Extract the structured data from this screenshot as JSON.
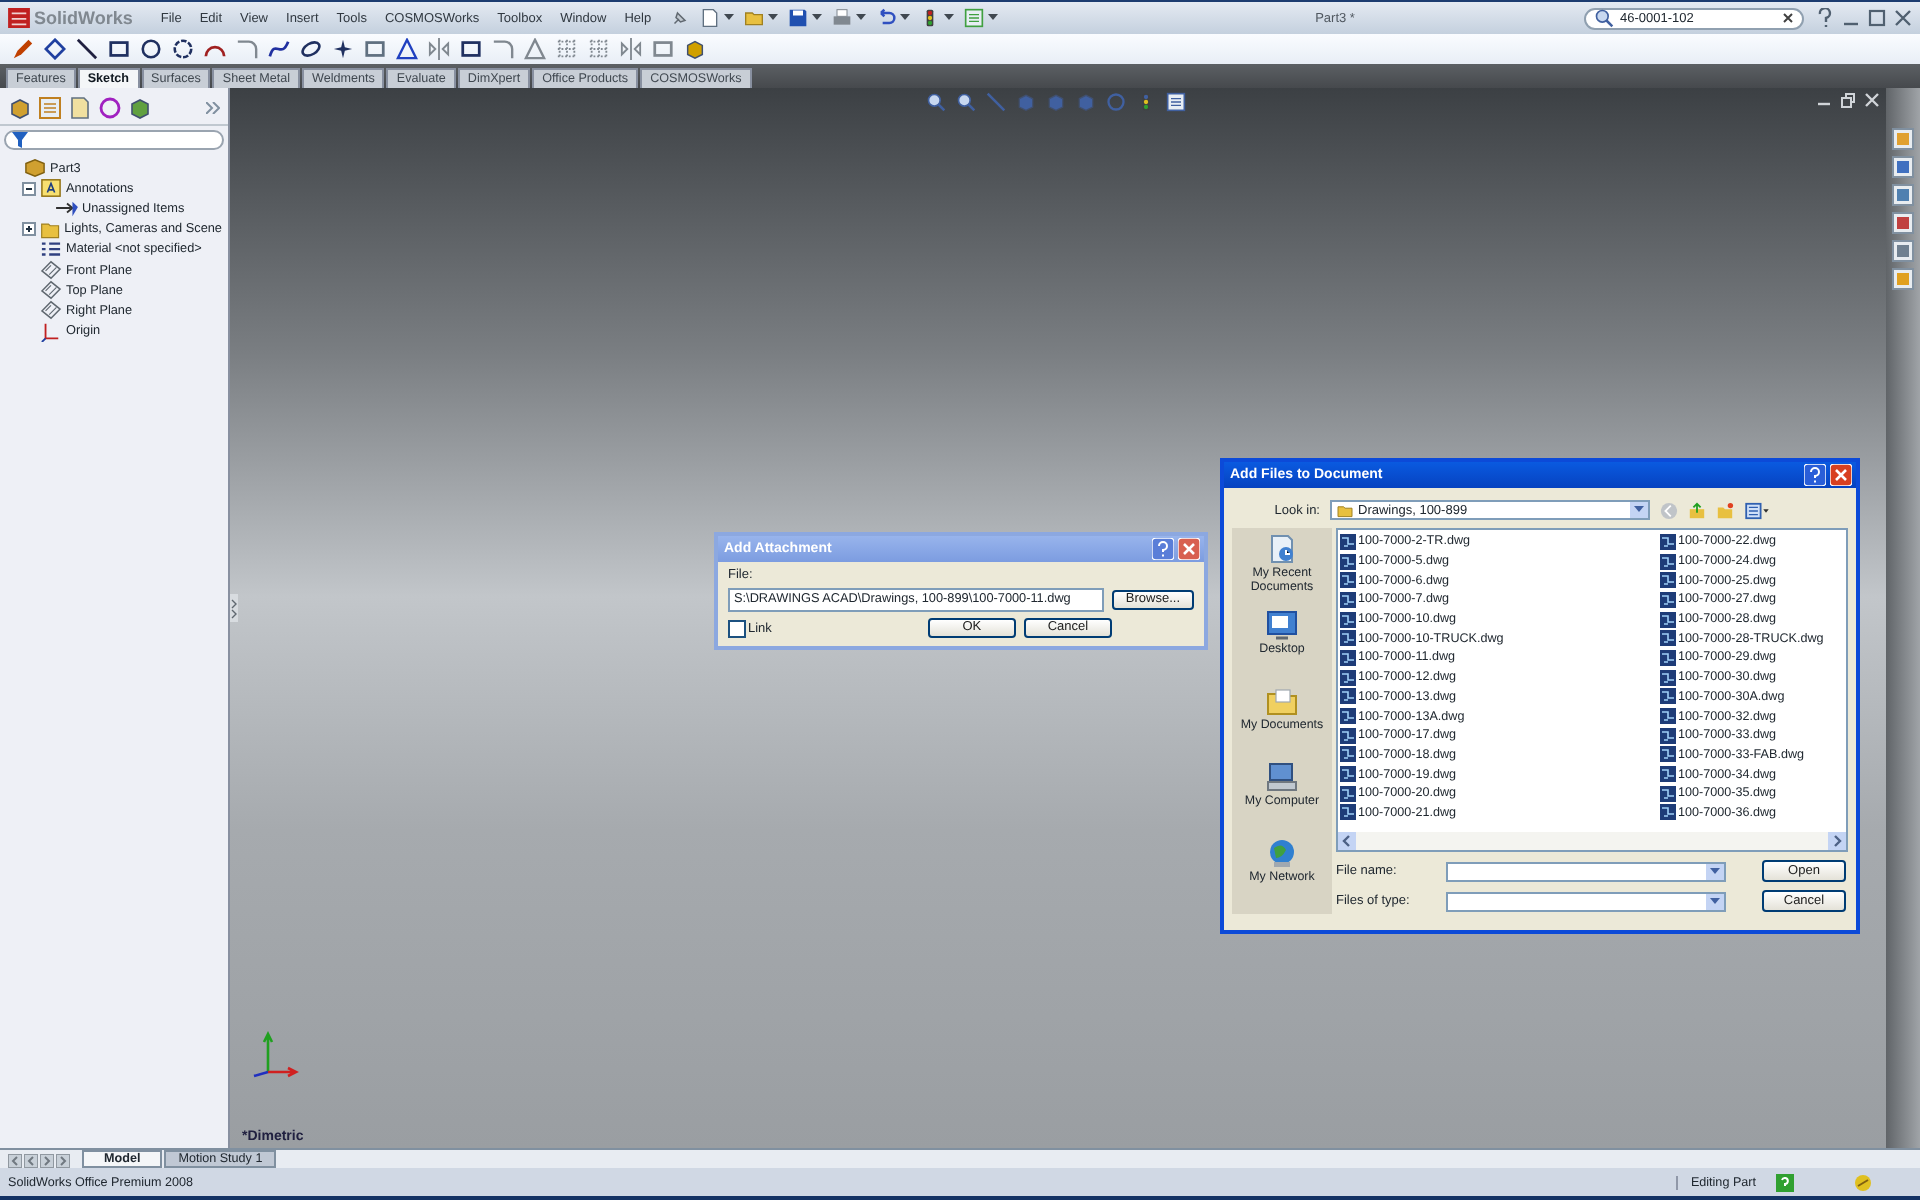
{
  "window": {
    "title": "Part3 *"
  },
  "app_logo": "SolidWorks",
  "menu": [
    "File",
    "Edit",
    "View",
    "Insert",
    "Tools",
    "COSMOSWorks",
    "Toolbox",
    "Window",
    "Help"
  ],
  "search": {
    "value": "46-0001-102"
  },
  "command_tabs": [
    {
      "label": "Features",
      "selected": false
    },
    {
      "label": "Sketch",
      "selected": true
    },
    {
      "label": "Surfaces",
      "selected": false
    },
    {
      "label": "Sheet Metal",
      "selected": false
    },
    {
      "label": "Weldments",
      "selected": false
    },
    {
      "label": "Evaluate",
      "selected": false
    },
    {
      "label": "DimXpert",
      "selected": false
    },
    {
      "label": "Office Products",
      "selected": false
    },
    {
      "label": "COSMOSWorks",
      "selected": false
    }
  ],
  "feature_tree": {
    "items": [
      {
        "label": "Part3",
        "kind": "part",
        "children": [
          {
            "label": "Annotations",
            "kind": "annotations",
            "expanded": true,
            "children": [
              {
                "label": "Unassigned Items",
                "kind": "unassigned"
              }
            ]
          },
          {
            "label": "Lights, Cameras and Scene",
            "kind": "lights",
            "expanded": false
          },
          {
            "label": "Material <not specified>",
            "kind": "material"
          },
          {
            "label": "Front Plane",
            "kind": "plane"
          },
          {
            "label": "Top Plane",
            "kind": "plane"
          },
          {
            "label": "Right Plane",
            "kind": "plane"
          },
          {
            "label": "Origin",
            "kind": "origin"
          }
        ]
      }
    ]
  },
  "viewport": {
    "view_label": "*Dimetric"
  },
  "add_attachment": {
    "title": "Add Attachment",
    "file_label": "File:",
    "file_value": "S:\\DRAWINGS ACAD\\Drawings, 100-899\\100-7000-11.dwg",
    "browse": "Browse...",
    "link": {
      "label": "Link",
      "checked": false
    },
    "buttons": [
      "OK",
      "Cancel"
    ]
  },
  "add_files": {
    "title": "Add Files to Document",
    "look_in_label": "Look in:",
    "look_in": "Drawings, 100-899",
    "places": [
      {
        "label": "My Recent Documents",
        "kind": "recent"
      },
      {
        "label": "Desktop",
        "kind": "desktop"
      },
      {
        "label": "My Documents",
        "kind": "documents"
      },
      {
        "label": "My Computer",
        "kind": "computer"
      },
      {
        "label": "My Network",
        "kind": "network"
      }
    ],
    "files": [
      "100-7000-2-TR.dwg",
      "100-7000-5.dwg",
      "100-7000-6.dwg",
      "100-7000-7.dwg",
      "100-7000-10.dwg",
      "100-7000-10-TRUCK.dwg",
      "100-7000-11.dwg",
      "100-7000-12.dwg",
      "100-7000-13.dwg",
      "100-7000-13A.dwg",
      "100-7000-17.dwg",
      "100-7000-18.dwg",
      "100-7000-19.dwg",
      "100-7000-20.dwg",
      "100-7000-21.dwg",
      "100-7000-22.dwg",
      "100-7000-24.dwg",
      "100-7000-25.dwg",
      "100-7000-27.dwg",
      "100-7000-28.dwg",
      "100-7000-28-TRUCK.dwg",
      "100-7000-29.dwg",
      "100-7000-30.dwg",
      "100-7000-30A.dwg",
      "100-7000-32.dwg",
      "100-7000-33.dwg",
      "100-7000-33-FAB.dwg",
      "100-7000-34.dwg",
      "100-7000-35.dwg",
      "100-7000-36.dwg"
    ],
    "file_name_label": "File name:",
    "files_of_type_label": "Files of type:",
    "buttons": [
      "Open",
      "Cancel"
    ]
  },
  "bottom_tabs": [
    {
      "label": "Model",
      "selected": true
    },
    {
      "label": "Motion Study 1",
      "selected": false
    }
  ],
  "status_bar": {
    "product": "SolidWorks Office Premium 2008",
    "mode": "Editing Part"
  }
}
